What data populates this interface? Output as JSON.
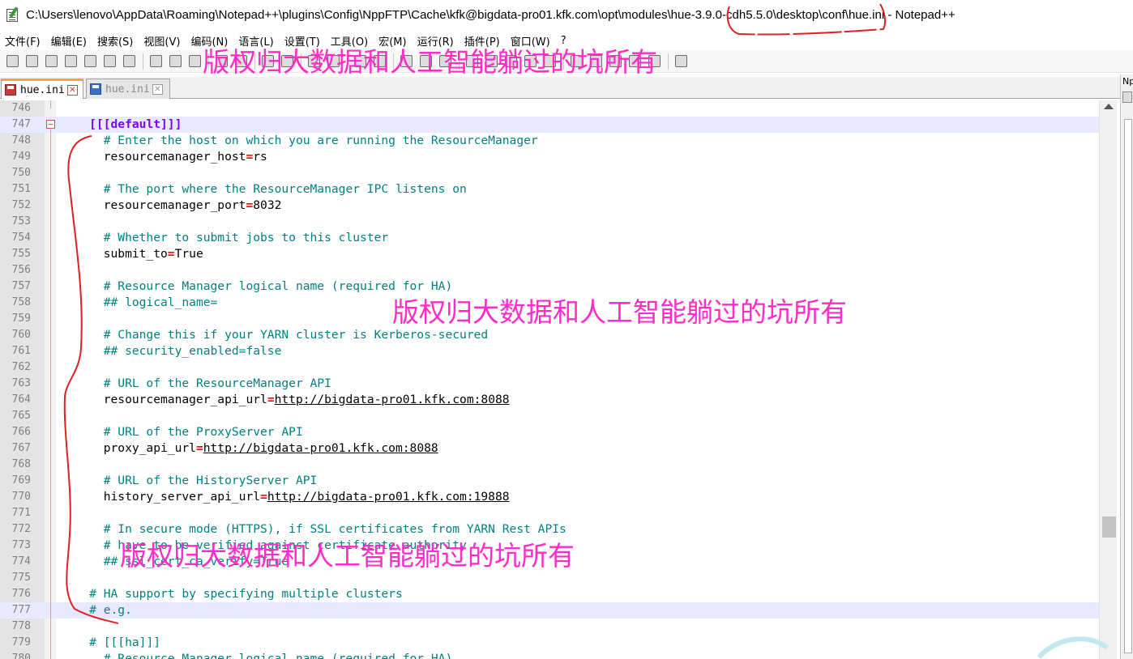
{
  "window": {
    "title": "C:\\Users\\lenovo\\AppData\\Roaming\\Notepad++\\plugins\\Config\\NppFTP\\Cache\\kfk@bigdata-pro01.kfk.com\\opt\\modules\\hue-3.9.0-cdh5.5.0\\desktop\\conf\\hue.ini - Notepad++"
  },
  "menu": [
    "文件(F)",
    "编辑(E)",
    "搜索(S)",
    "视图(V)",
    "编码(N)",
    "语言(L)",
    "设置(T)",
    "工具(O)",
    "宏(M)",
    "运行(R)",
    "插件(P)",
    "窗口(W)",
    "?"
  ],
  "toolbar": {
    "buttons": [
      "new-file",
      "open-file",
      "save",
      "save-all",
      "close",
      "close-all",
      "print",
      "cut",
      "copy",
      "paste",
      "undo",
      "redo",
      "find",
      "replace",
      "zoom-in",
      "zoom-out",
      "sync-v",
      "sync-h",
      "word-wrap",
      "show-all",
      "indent-guide",
      "udl",
      "doc-map",
      "function-list",
      "folder-workspace",
      "monitor",
      "record-macro",
      "stop-macro",
      "play-macro",
      "run-macro-multi",
      "save-macro",
      "ftp"
    ]
  },
  "tabs": [
    {
      "label": "hue.ini",
      "active": true
    },
    {
      "label": "hue.ini",
      "active": false
    }
  ],
  "side_panel": {
    "label": "Np"
  },
  "colors": {
    "comment": "#008080",
    "section": "#8000ff",
    "operator": "#ff0000",
    "current_line": "#e8e8ff",
    "watermark": "#ff2cc8",
    "annotation": "#e02020"
  },
  "editor": {
    "lines": [
      {
        "n": "746",
        "code": "",
        "fold": "end"
      },
      {
        "n": "747",
        "code": "[[[default]]]",
        "indent": "    ",
        "kind": "section",
        "fold": "open",
        "hl": true
      },
      {
        "n": "748",
        "code": "# Enter the host on which you are running the ResourceManager",
        "indent": "      ",
        "kind": "comment"
      },
      {
        "n": "749",
        "key": "resourcemanager_host",
        "value": "rs",
        "indent": "      ",
        "kind": "kv"
      },
      {
        "n": "750",
        "code": "",
        "kind": "blank"
      },
      {
        "n": "751",
        "code": "# The port where the ResourceManager IPC listens on",
        "indent": "      ",
        "kind": "comment"
      },
      {
        "n": "752",
        "key": "resourcemanager_port",
        "value": "8032",
        "indent": "      ",
        "kind": "kv"
      },
      {
        "n": "753",
        "code": "",
        "kind": "blank"
      },
      {
        "n": "754",
        "code": "# Whether to submit jobs to this cluster",
        "indent": "      ",
        "kind": "comment"
      },
      {
        "n": "755",
        "key": "submit_to",
        "value": "True",
        "indent": "      ",
        "kind": "kv"
      },
      {
        "n": "756",
        "code": "",
        "kind": "blank"
      },
      {
        "n": "757",
        "code": "# Resource Manager logical name (required for HA)",
        "indent": "      ",
        "kind": "comment"
      },
      {
        "n": "758",
        "code": "## logical_name=",
        "indent": "      ",
        "kind": "comment"
      },
      {
        "n": "759",
        "code": "",
        "kind": "blank"
      },
      {
        "n": "760",
        "code": "# Change this if your YARN cluster is Kerberos-secured",
        "indent": "      ",
        "kind": "comment"
      },
      {
        "n": "761",
        "code": "## security_enabled=false",
        "indent": "      ",
        "kind": "comment"
      },
      {
        "n": "762",
        "code": "",
        "kind": "blank"
      },
      {
        "n": "763",
        "code": "# URL of the ResourceManager API",
        "indent": "      ",
        "kind": "comment"
      },
      {
        "n": "764",
        "key": "resourcemanager_api_url",
        "value": "http://bigdata-pro01.kfk.com:8088",
        "indent": "      ",
        "kind": "kv",
        "url": true
      },
      {
        "n": "765",
        "code": "",
        "kind": "blank"
      },
      {
        "n": "766",
        "code": "# URL of the ProxyServer API",
        "indent": "      ",
        "kind": "comment"
      },
      {
        "n": "767",
        "key": "proxy_api_url",
        "value": "http://bigdata-pro01.kfk.com:8088",
        "indent": "      ",
        "kind": "kv",
        "url": true
      },
      {
        "n": "768",
        "code": "",
        "kind": "blank"
      },
      {
        "n": "769",
        "code": "# URL of the HistoryServer API",
        "indent": "      ",
        "kind": "comment"
      },
      {
        "n": "770",
        "key": "history_server_api_url",
        "value": "http://bigdata-pro01.kfk.com:19888",
        "indent": "      ",
        "kind": "kv",
        "url": true
      },
      {
        "n": "771",
        "code": "",
        "kind": "blank"
      },
      {
        "n": "772",
        "code": "# In secure mode (HTTPS), if SSL certificates from YARN Rest APIs",
        "indent": "      ",
        "kind": "comment"
      },
      {
        "n": "773",
        "code": "# have to be verified against certificate authority",
        "indent": "      ",
        "kind": "comment"
      },
      {
        "n": "774",
        "code": "## ssl_cert_ca_verify=True",
        "indent": "      ",
        "kind": "comment"
      },
      {
        "n": "775",
        "code": "",
        "kind": "blank"
      },
      {
        "n": "776",
        "code": "# HA support by specifying multiple clusters",
        "indent": "    ",
        "kind": "comment"
      },
      {
        "n": "777",
        "code": "# e.g.",
        "indent": "    ",
        "kind": "comment",
        "hl": true
      },
      {
        "n": "778",
        "code": "",
        "kind": "blank"
      },
      {
        "n": "779",
        "code": "# [[[ha]]]",
        "indent": "    ",
        "kind": "comment"
      },
      {
        "n": "780",
        "code": "# Resource Manager logical name (required for HA)",
        "indent": "      ",
        "kind": "comment"
      }
    ]
  },
  "watermarks": [
    {
      "text": "版权归大数据和人工智能躺过的坑所有"
    },
    {
      "text": "版权归大数据和人工智能躺过的坑所有"
    },
    {
      "text": "版权归大数据和人工智能躺过的坑所有"
    }
  ]
}
